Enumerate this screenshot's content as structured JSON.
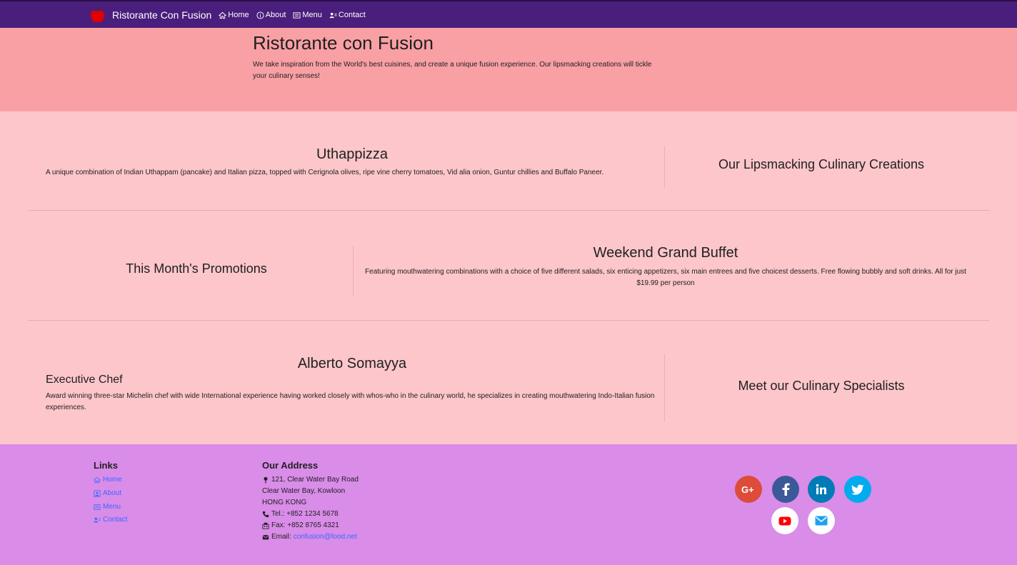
{
  "navbar": {
    "brand": "Ristorante Con Fusion",
    "links": [
      {
        "label": "Home",
        "icon": "home-icon"
      },
      {
        "label": "About",
        "icon": "info-icon"
      },
      {
        "label": "Menu",
        "icon": "list-icon"
      },
      {
        "label": "Contact",
        "icon": "address-card-icon"
      }
    ],
    "colors": {
      "background": "#4a1e7c",
      "logo": "#e00000"
    }
  },
  "jumbotron": {
    "title": "Ristorante con Fusion",
    "text": "We take inspiration from the World's best cuisines, and create a unique fusion experience. Our lipsmacking creations will tickle your culinary senses!",
    "color": "#f9a0a5"
  },
  "sections": {
    "dish": {
      "title": "Uthappizza",
      "description": "A unique combination of Indian Uthappam (pancake) and Italian pizza, topped with Cerignola olives, ripe vine cherry tomatoes, Vid alia onion, Guntur chillies and Buffalo Paneer.",
      "side_title": "Our Lipsmacking Culinary Creations"
    },
    "promotion": {
      "side_title": "This Month's Promotions",
      "title": "Weekend Grand Buffet",
      "description": "Featuring mouthwatering combinations with a choice of five different salads, six enticing appetizers, six main entrees and five choicest desserts. Free flowing bubbly and soft drinks. All for just $19.99 per person"
    },
    "leader": {
      "title": "Alberto Somayya",
      "designation": "Executive Chef",
      "description": "Award winning three-star Michelin chef with wide International experience having worked closely with whos-who in the culinary world, he specializes in creating mouthwatering Indo-Italian fusion experiences.",
      "side_title": "Meet our Culinary Specialists"
    },
    "background": "#fcc6ca"
  },
  "footer": {
    "links_heading": "Links",
    "links": [
      {
        "label": "Home",
        "icon": "home-icon"
      },
      {
        "label": "About",
        "icon": "user-icon"
      },
      {
        "label": "Menu",
        "icon": "list-icon"
      },
      {
        "label": "Contact",
        "icon": "address-card-icon"
      }
    ],
    "address_heading": "Our Address",
    "address": {
      "line1": "121, Clear Water Bay Road",
      "line2": "Clear Water Bay, Kowloon",
      "line3": "HONG KONG",
      "tel": "Tel.: +852 1234 5678",
      "fax": "Fax: +852 8765 4321",
      "email_label": "Email:",
      "email": "confusion@food.net"
    },
    "social": [
      {
        "name": "google-plus-icon",
        "color": "#dd4b39"
      },
      {
        "name": "facebook-icon",
        "color": "#3b5998"
      },
      {
        "name": "linkedin-icon",
        "color": "#007bb6"
      },
      {
        "name": "twitter-icon",
        "color": "#00aced"
      },
      {
        "name": "youtube-icon",
        "color": "#ff0000"
      },
      {
        "name": "mail-icon",
        "color": "#1da1f2"
      }
    ],
    "color": "#d98ce8"
  }
}
